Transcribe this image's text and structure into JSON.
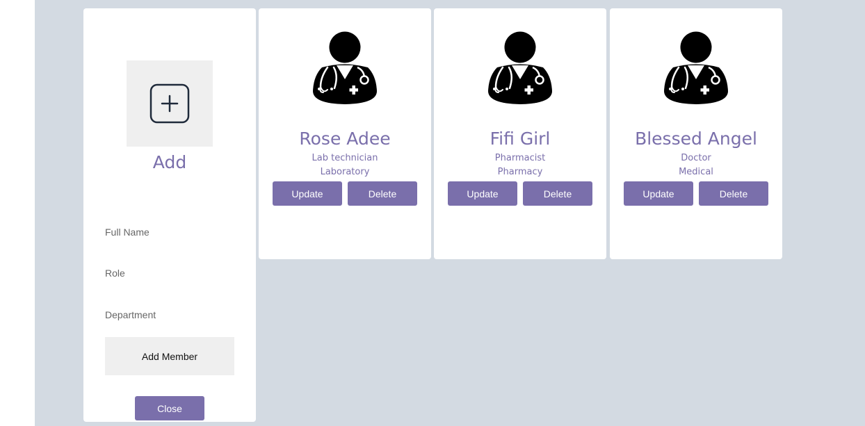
{
  "add_panel": {
    "title": "Add",
    "fields": [
      {
        "label": "Full Name",
        "value": ""
      },
      {
        "label": "Role",
        "value": ""
      },
      {
        "label": "Department",
        "value": ""
      }
    ],
    "submit_label": "Add Member",
    "close_label": "Close"
  },
  "members": [
    {
      "name": "Rose Adee",
      "role": "Lab technician",
      "department": "Laboratory",
      "update_label": "Update",
      "delete_label": "Delete"
    },
    {
      "name": "Fifi Girl",
      "role": "Pharmacist",
      "department": "Pharmacy",
      "update_label": "Update",
      "delete_label": "Delete"
    },
    {
      "name": "Blessed Angel",
      "role": "Doctor",
      "department": "Medical",
      "update_label": "Update",
      "delete_label": "Delete"
    }
  ],
  "icons": {
    "add": "plus-square-icon",
    "avatar": "doctor-avatar-icon"
  },
  "colors": {
    "accent": "#7a6fab",
    "background": "#d3dae2",
    "panel": "#ffffff"
  }
}
